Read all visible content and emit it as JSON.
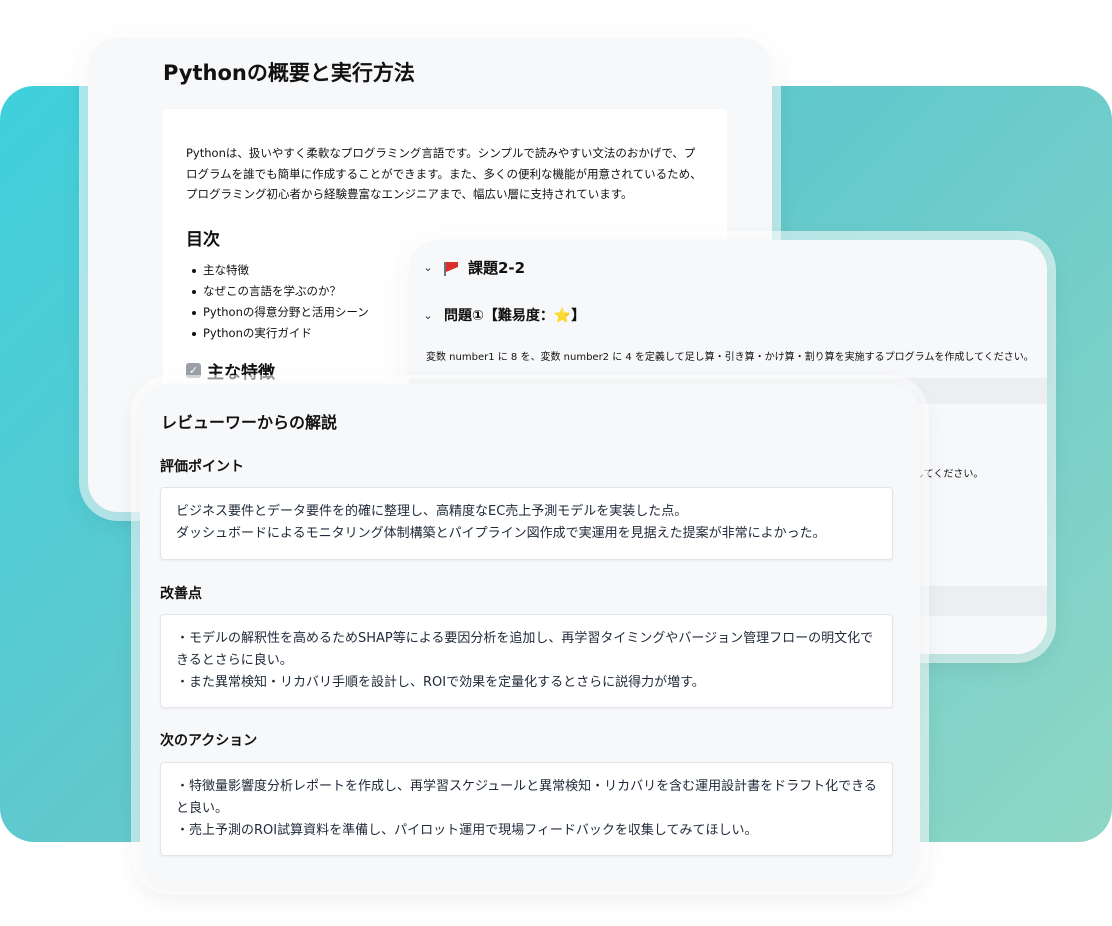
{
  "python_doc": {
    "title": "Pythonの概要と実行方法",
    "intro": "Pythonは、扱いやすく柔軟なプログラミング言語です。シンプルで読みやすい文法のおかげで、プログラムを誰でも簡単に作成することができます。また、多くの便利な機能が用意されているため、プログラミング初心者から経験豊富なエンジニアまで、幅広い層に支持されています。",
    "toc_heading": "目次",
    "toc": [
      "主な特徴",
      "なぜこの言語を学ぶのか？",
      "Pythonの得意分野と活用シーン",
      "Pythonの実行ガイド"
    ],
    "features_heading": "主な特徴",
    "features_icon": "check-box-icon"
  },
  "task": {
    "title": "課題2-2",
    "title_icon": "red-flag-icon",
    "question_title": "問題①【難易度：",
    "question_star": "⭐",
    "question_suffix": "】",
    "description": "変数 number1 に 8 を、変数 number2 に 4 を定義して足し算・引き算・かけ算・割り算を実施するプログラムを作成してください。",
    "fragment": "たしてください。"
  },
  "review": {
    "title": "レビューワーからの解説",
    "sections": [
      {
        "label": "評価ポイント",
        "lines": [
          "ビジネス要件とデータ要件を的確に整理し、高精度なEC売上予測モデルを実装した点。",
          "ダッシュボードによるモニタリング体制構築とパイプライン図作成で実運用を見据えた提案が非常によかった。"
        ]
      },
      {
        "label": "改善点",
        "lines": [
          "・モデルの解釈性を高めるためSHAP等による要因分析を追加し、再学習タイミングやバージョン管理フローの明文化できるとさらに良い。",
          "・また異常検知・リカバリ手順を設計し、ROIで効果を定量化するとさらに説得力が増す。"
        ]
      },
      {
        "label": "次のアクション",
        "lines": [
          "・特徴量影響度分析レポートを作成し、再学習スケジュールと異常検知・リカバリを含む運用設計書をドラフト化できると良い。",
          "・売上予測のROI試算資料を準備し、パイロット運用で現場フィードバックを収集してみてほしい。"
        ]
      }
    ]
  },
  "colors": {
    "gradient_start": "#3fd0dc",
    "gradient_end": "#8fd7c6",
    "flag": "#d9302c",
    "star": "#f5b301"
  }
}
